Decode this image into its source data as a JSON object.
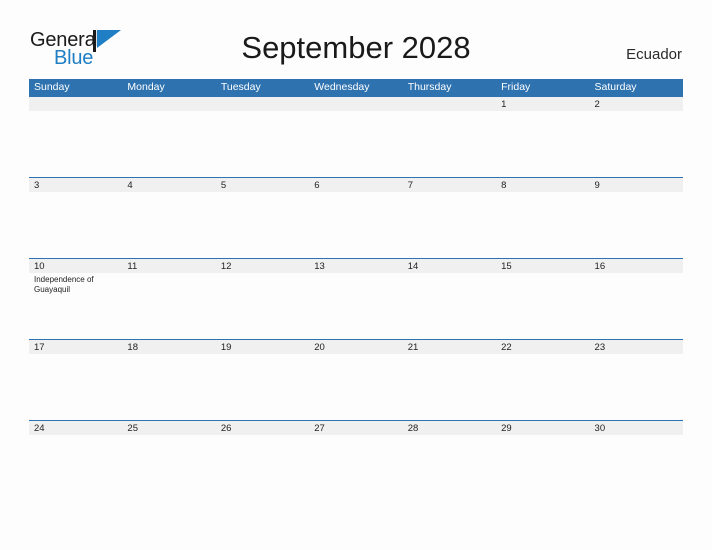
{
  "brand": {
    "name_part1": "General",
    "name_part2": "Blue",
    "flag_icon": "flag-triangle-icon",
    "accent_color": "#1f7ec4"
  },
  "header": {
    "title": "September 2028",
    "country": "Ecuador"
  },
  "colors": {
    "header_blue": "#2e72b0",
    "date_band_gray": "#f0f0f0",
    "page_background": "#fdfdfd",
    "text_dark": "#222222"
  },
  "calendar": {
    "month": "September",
    "year": "2028",
    "weekday_headers": [
      "Sunday",
      "Monday",
      "Tuesday",
      "Wednesday",
      "Thursday",
      "Friday",
      "Saturday"
    ],
    "weeks": [
      [
        {
          "day": "",
          "holiday": ""
        },
        {
          "day": "",
          "holiday": ""
        },
        {
          "day": "",
          "holiday": ""
        },
        {
          "day": "",
          "holiday": ""
        },
        {
          "day": "",
          "holiday": ""
        },
        {
          "day": "1",
          "holiday": ""
        },
        {
          "day": "2",
          "holiday": ""
        }
      ],
      [
        {
          "day": "3",
          "holiday": ""
        },
        {
          "day": "4",
          "holiday": ""
        },
        {
          "day": "5",
          "holiday": ""
        },
        {
          "day": "6",
          "holiday": ""
        },
        {
          "day": "7",
          "holiday": ""
        },
        {
          "day": "8",
          "holiday": ""
        },
        {
          "day": "9",
          "holiday": ""
        }
      ],
      [
        {
          "day": "10",
          "holiday": "Independence of Guayaquil"
        },
        {
          "day": "11",
          "holiday": ""
        },
        {
          "day": "12",
          "holiday": ""
        },
        {
          "day": "13",
          "holiday": ""
        },
        {
          "day": "14",
          "holiday": ""
        },
        {
          "day": "15",
          "holiday": ""
        },
        {
          "day": "16",
          "holiday": ""
        }
      ],
      [
        {
          "day": "17",
          "holiday": ""
        },
        {
          "day": "18",
          "holiday": ""
        },
        {
          "day": "19",
          "holiday": ""
        },
        {
          "day": "20",
          "holiday": ""
        },
        {
          "day": "21",
          "holiday": ""
        },
        {
          "day": "22",
          "holiday": ""
        },
        {
          "day": "23",
          "holiday": ""
        }
      ],
      [
        {
          "day": "24",
          "holiday": ""
        },
        {
          "day": "25",
          "holiday": ""
        },
        {
          "day": "26",
          "holiday": ""
        },
        {
          "day": "27",
          "holiday": ""
        },
        {
          "day": "28",
          "holiday": ""
        },
        {
          "day": "29",
          "holiday": ""
        },
        {
          "day": "30",
          "holiday": ""
        }
      ]
    ]
  }
}
